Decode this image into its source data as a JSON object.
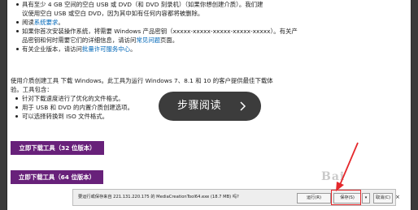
{
  "requirements": {
    "items": [
      {
        "line1": "具有至少 4 GB 空间的空白 USB 或 DVD（和 DVD 刻录机）（如果你想创建介质）。我们建",
        "line2": "议使用空白 USB 或空白 DVD，因为其中如有任何内容都将被删除。"
      },
      {
        "prefix": "阅读",
        "link": "系统要求",
        "suffix": "。"
      },
      {
        "line1": "如果你首次安装操作系统，将需要 Windows 产品密钥（xxxxx-xxxxx-xxxxx-xxxxx-xxxxx）。有关产",
        "line2_prefix": "品密钥和何时需要它们的详细信息，请访问",
        "line2_link": "常见问题",
        "line2_suffix": "页面。"
      },
      {
        "prefix": "有关企业版本，请访问",
        "link": "批量许可服务中心",
        "suffix": "。"
      }
    ]
  },
  "intro": {
    "line1": "使用介质创建工具 下载 Windows。此工具为运行 Windows 7、8.1 和 10 的客户提供最佳下载体",
    "line2": "验。工具包含：",
    "features": [
      "针对下载速度进行了优化的文件格式。",
      "用于 USB 和 DVD 的内置介质创建选项。",
      "可以选择转换到 ISO 文件格式。"
    ]
  },
  "buttons": {
    "download_32": "立即下载工具（32 位版本）",
    "download_64": "立即下载工具（64 位版本）"
  },
  "overlay": {
    "label": "步骤阅读"
  },
  "download_bar": {
    "message": "要运行或保存来自 221.131.220.175 的 MediaCreationTool64.exe (18.7 MB) 吗?",
    "run": "运行(R)",
    "save": "保存(S)",
    "dropdown": "▾",
    "cancel": "取消(C)",
    "close": "×"
  },
  "watermark": "Bai"
}
